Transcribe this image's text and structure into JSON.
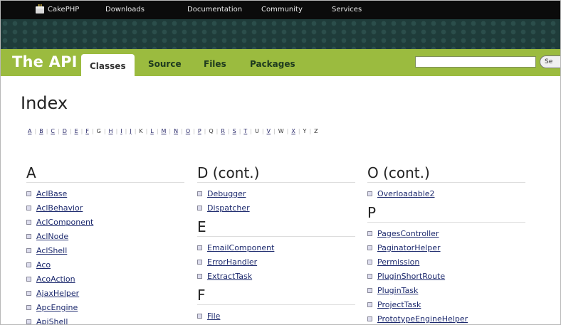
{
  "topnav": {
    "items": [
      "CakePHP",
      "Downloads",
      "Documentation",
      "Community",
      "Services"
    ]
  },
  "header": {
    "brand": "The API",
    "tabs": [
      "Classes",
      "Source",
      "Files",
      "Packages"
    ],
    "active_tab": "Classes",
    "search_button": "Se"
  },
  "main": {
    "title": "Index",
    "letters": [
      "A",
      "B",
      "C",
      "D",
      "E",
      "F",
      "G",
      "H",
      "I",
      "J",
      "K",
      "L",
      "M",
      "N",
      "O",
      "P",
      "Q",
      "R",
      "S",
      "T",
      "U",
      "V",
      "W",
      "X",
      "Y",
      "Z"
    ],
    "linked_letters": [
      "A",
      "B",
      "C",
      "D",
      "E",
      "F",
      "H",
      "I",
      "J",
      "L",
      "M",
      "N",
      "O",
      "P",
      "R",
      "S",
      "T",
      "V",
      "X"
    ],
    "columns": [
      {
        "sections": [
          {
            "heading": "A",
            "items": [
              "AclBase",
              "AclBehavior",
              "AclComponent",
              "AclNode",
              "AclShell",
              "Aco",
              "AcoAction",
              "AjaxHelper",
              "ApcEngine",
              "ApiShell"
            ]
          }
        ]
      },
      {
        "sections": [
          {
            "heading": "D (cont.)",
            "items": [
              "Debugger",
              "Dispatcher"
            ]
          },
          {
            "heading": "E",
            "items": [
              "EmailComponent",
              "ErrorHandler",
              "ExtractTask"
            ]
          },
          {
            "heading": "F",
            "items": [
              "File"
            ]
          }
        ]
      },
      {
        "sections": [
          {
            "heading": "O (cont.)",
            "items": [
              "Overloadable2"
            ]
          },
          {
            "heading": "P",
            "items": [
              "PagesController",
              "PaginatorHelper",
              "Permission",
              "PluginShortRoute",
              "PluginTask",
              "ProjectTask",
              "PrototypeEngineHelper"
            ]
          }
        ]
      }
    ]
  }
}
